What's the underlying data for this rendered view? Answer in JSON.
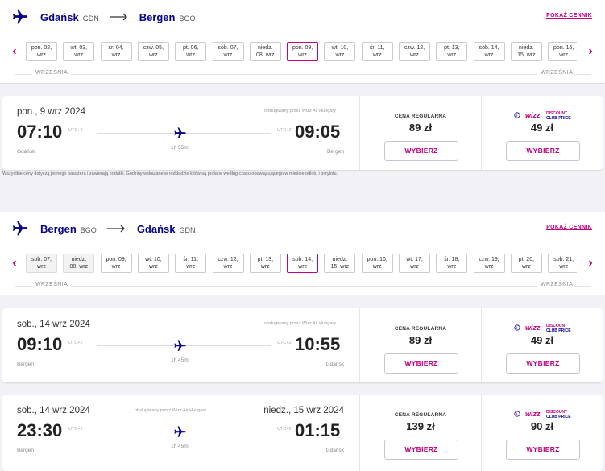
{
  "outbound": {
    "header": {
      "from_city": "Gdańsk",
      "from_code": "GDN",
      "to_city": "Bergen",
      "to_code": "BGO",
      "price_list_link": "POKAŻ CENNIK"
    },
    "dates": [
      {
        "day": "pon. 02,",
        "month": "wrz"
      },
      {
        "day": "wt. 03,",
        "month": "wrz"
      },
      {
        "day": "śr. 04,",
        "month": "wrz"
      },
      {
        "day": "czw. 05,",
        "month": "wrz"
      },
      {
        "day": "pt. 06,",
        "month": "wrz"
      },
      {
        "day": "sob. 07,",
        "month": "wrz"
      },
      {
        "day": "niedz.",
        "month": "08, wrz"
      },
      {
        "day": "pon. 09,",
        "month": "wrz",
        "selected": true
      },
      {
        "day": "wt. 10,",
        "month": "wrz"
      },
      {
        "day": "śr. 11,",
        "month": "wrz"
      },
      {
        "day": "czw. 12,",
        "month": "wrz"
      },
      {
        "day": "pt. 13,",
        "month": "wrz"
      },
      {
        "day": "sob. 14,",
        "month": "wrz"
      },
      {
        "day": "niedz.",
        "month": "15, wrz"
      },
      {
        "day": "pon. 16,",
        "month": "wrz"
      }
    ],
    "month_label_left": "WRZEŚNIA",
    "month_label_right": "WRZEŚNIA",
    "flights": [
      {
        "date": "pon., 9 wrz 2024",
        "operator": "obsługiwany przez Wizz Air Hungary",
        "dep_time": "07:10",
        "dep_utc": "UTC+2",
        "dep_airport": "Gdańsk",
        "arr_time": "09:05",
        "arr_utc": "UTC+2",
        "arr_airport": "Bergen",
        "duration": "1h 55m",
        "regular_label": "CENA REGULARNA",
        "regular_price": "89 zł",
        "club_price": "49 zł",
        "select_label": "WYBIERZ"
      }
    ]
  },
  "disclaimer": "Wszystkie ceny dotyczą jednego pasażera i zawierają podatki. Godziny wskazane w rozkładzie lotów są podane według czasu obowiązującego w mieście odlotu i przylotu.",
  "inbound": {
    "header": {
      "from_city": "Bergen",
      "from_code": "BGO",
      "to_city": "Gdańsk",
      "to_code": "GDN",
      "price_list_link": "POKAŻ CENNIK"
    },
    "dates": [
      {
        "day": "sob. 07,",
        "month": "wrz",
        "gray": true
      },
      {
        "day": "niedz.",
        "month": "08, wrz",
        "gray": true
      },
      {
        "day": "pon. 09,",
        "month": "wrz"
      },
      {
        "day": "wt. 10,",
        "month": "wrz"
      },
      {
        "day": "śr. 11,",
        "month": "wrz"
      },
      {
        "day": "czw. 12,",
        "month": "wrz"
      },
      {
        "day": "pt. 13,",
        "month": "wrz"
      },
      {
        "day": "sob. 14,",
        "month": "wrz",
        "selected": true
      },
      {
        "day": "niedz.",
        "month": "15, wrz"
      },
      {
        "day": "pon. 16,",
        "month": "wrz"
      },
      {
        "day": "wt. 17,",
        "month": "wrz"
      },
      {
        "day": "śr. 18,",
        "month": "wrz"
      },
      {
        "day": "czw. 19,",
        "month": "wrz"
      },
      {
        "day": "pt. 20,",
        "month": "wrz"
      },
      {
        "day": "sob. 21,",
        "month": "wrz"
      }
    ],
    "month_label_left": "WRZEŚNIA",
    "month_label_right": "WRZEŚNIA",
    "flights": [
      {
        "date": "sob., 14 wrz 2024",
        "operator": "obsługiwany przez Wizz Air Hungary",
        "dep_time": "09:10",
        "dep_utc": "UTC+2",
        "dep_airport": "Bergen",
        "arr_time": "10:55",
        "arr_utc": "UTC+2",
        "arr_airport": "Gdańsk",
        "duration": "1h 45m",
        "regular_label": "CENA REGULARNA",
        "regular_price": "89 zł",
        "club_price": "49 zł",
        "select_label": "WYBIERZ"
      },
      {
        "date": "sob., 14 wrz 2024",
        "arr_date": "niedz., 15 wrz 2024",
        "operator": "obsługiwany przez Wizz Air Hungary",
        "dep_time": "23:30",
        "dep_utc": "UTC+2",
        "dep_airport": "Bergen",
        "arr_time": "01:15",
        "arr_utc": "UTC+2",
        "arr_airport": "Gdańsk",
        "duration": "1h 45m",
        "regular_label": "CENA REGULARNA",
        "regular_price": "139 zł",
        "club_price": "90 zł",
        "select_label": "WYBIERZ"
      }
    ]
  },
  "icons": {
    "plane": "plane-icon",
    "arrow": "arrow-right-icon",
    "prev": "chevron-left-icon",
    "next": "chevron-right-icon",
    "info": "info-icon"
  },
  "colors": {
    "brand_blue": "#06038d",
    "brand_magenta": "#c6007e",
    "background": "#f2f2f6"
  }
}
